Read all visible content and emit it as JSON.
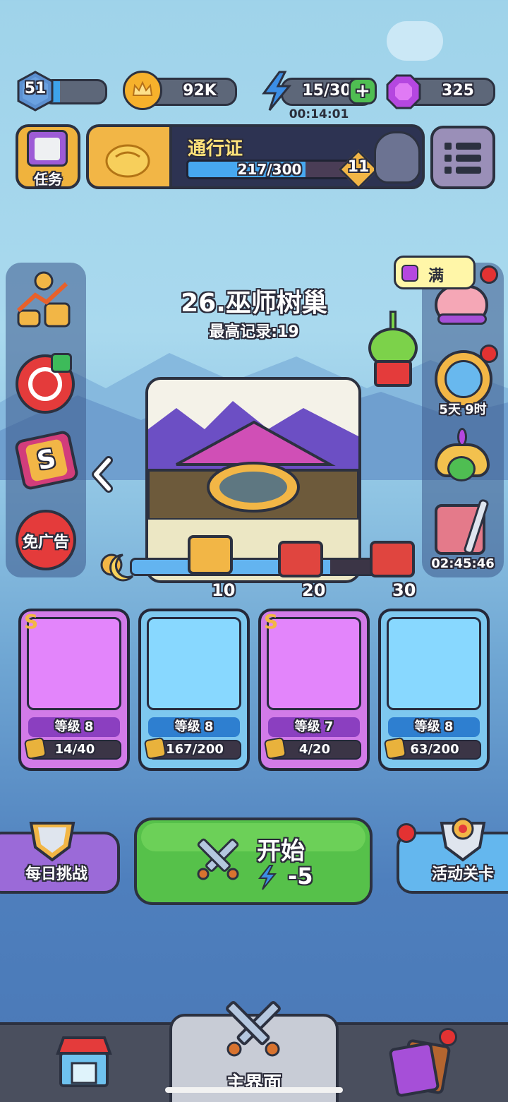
{
  "top": {
    "level": "51",
    "coins": "92K",
    "energy": "15/30",
    "energy_timer": "00:14:01",
    "gems": "325"
  },
  "quest": {
    "label": "任务"
  },
  "pass": {
    "title": "通行证",
    "progress_text": "217/300",
    "progress": 0.72,
    "level": "11"
  },
  "stage": {
    "name": "26.巫师树巢",
    "best_label": "最高记录:19"
  },
  "rewards": [
    {
      "label": "10"
    },
    {
      "label": "20"
    },
    {
      "label": "30"
    }
  ],
  "left_menu": {
    "no_ads": "免广告"
  },
  "right_menu": {
    "piggy_badge": "满",
    "wheel_timer": "5天 9时",
    "event_timer": "02:45:46"
  },
  "heroes": [
    {
      "rank": "S",
      "level": "等级 8",
      "fragments": "14/40",
      "progress": 0.35,
      "icon": "vampire-hero",
      "color": "#d27be8"
    },
    {
      "rank": "",
      "level": "等级 8",
      "fragments": "167/200",
      "progress": 0.835,
      "icon": "skeleton-knight-hero",
      "color": "#7ec8ef"
    },
    {
      "rank": "S",
      "level": "等级 7",
      "fragments": "4/20",
      "progress": 0.2,
      "icon": "crystal-mage-hero",
      "color": "#d27be8"
    },
    {
      "rank": "",
      "level": "等级 8",
      "fragments": "63/200",
      "progress": 0.315,
      "icon": "golem-hero",
      "color": "#7ec8ef"
    }
  ],
  "actions": {
    "daily": "每日挑战",
    "start": "开始",
    "start_cost": "-5",
    "event": "活动关卡"
  },
  "nav": {
    "main": "主界面"
  }
}
